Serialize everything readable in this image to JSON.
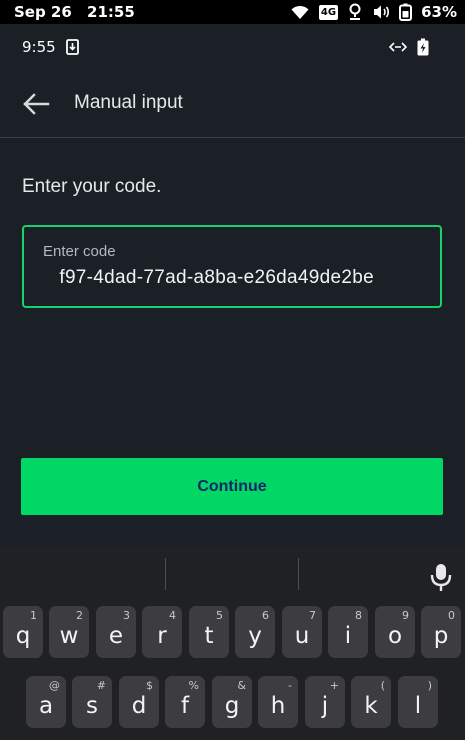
{
  "outer_status": {
    "date": "Sep 26",
    "time": "21:55",
    "network": "4G",
    "battery": "63%",
    "icons": [
      "wifi-icon",
      "network-4g-icon",
      "location-icon",
      "volume-icon",
      "battery-icon"
    ]
  },
  "inner_status": {
    "time": "9:55",
    "icons": [
      "download-icon",
      "data-saver-icon",
      "battery-charging-icon"
    ]
  },
  "appbar": {
    "back_icon": "arrow-left-icon",
    "title": "Manual input"
  },
  "form": {
    "prompt": "Enter your code.",
    "code_label": "Enter code",
    "code_value": "f97-4dad-77ad-a8ba-e26da49de2be",
    "continue_label": "Continue"
  },
  "colors": {
    "background": "#1b2026",
    "accent": "#00d765",
    "button_text": "#16246a",
    "keyboard": "#202124",
    "key": "#3c3c41"
  },
  "keyboard": {
    "mic_icon": "microphone-icon",
    "row1": [
      {
        "key": "q",
        "sub": "1"
      },
      {
        "key": "w",
        "sub": "2"
      },
      {
        "key": "e",
        "sub": "3"
      },
      {
        "key": "r",
        "sub": "4"
      },
      {
        "key": "t",
        "sub": "5"
      },
      {
        "key": "y",
        "sub": "6"
      },
      {
        "key": "u",
        "sub": "7"
      },
      {
        "key": "i",
        "sub": "8"
      },
      {
        "key": "o",
        "sub": "9"
      },
      {
        "key": "p",
        "sub": "0"
      }
    ],
    "row2": [
      {
        "key": "a",
        "sub": "@"
      },
      {
        "key": "s",
        "sub": "#"
      },
      {
        "key": "d",
        "sub": "$"
      },
      {
        "key": "f",
        "sub": "%"
      },
      {
        "key": "g",
        "sub": "&"
      },
      {
        "key": "h",
        "sub": "-"
      },
      {
        "key": "j",
        "sub": "+"
      },
      {
        "key": "k",
        "sub": "("
      },
      {
        "key": "l",
        "sub": ")"
      }
    ]
  }
}
